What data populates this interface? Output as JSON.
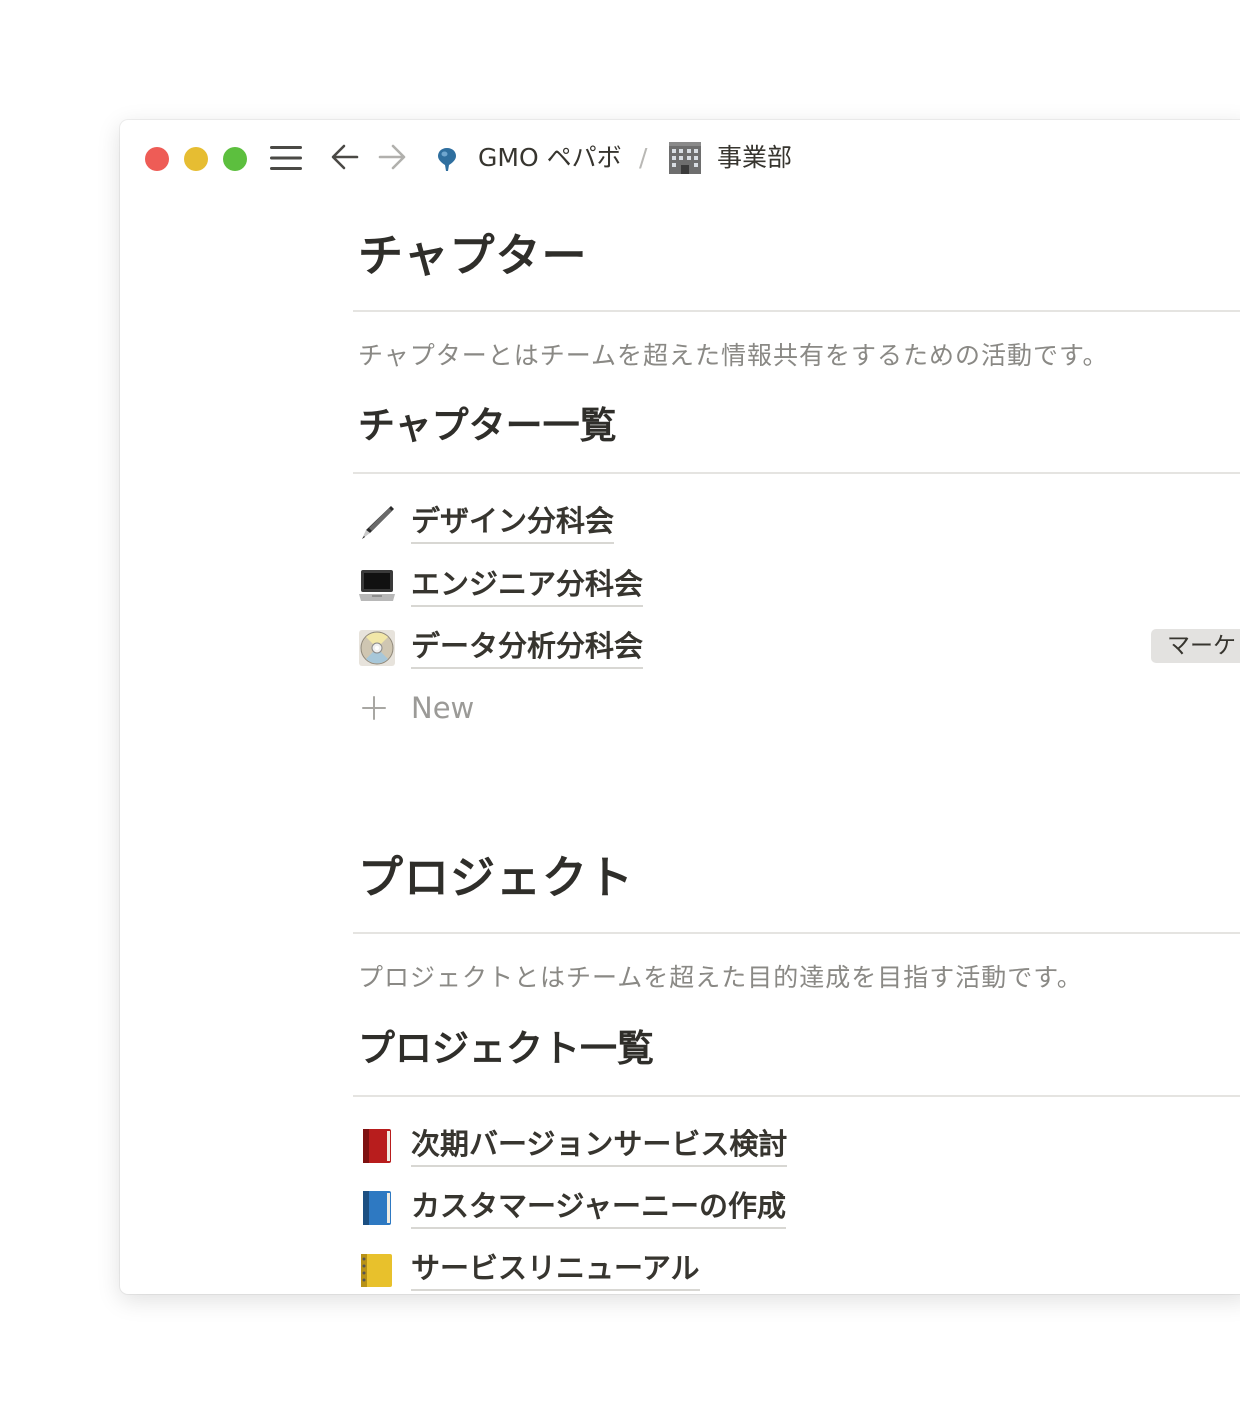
{
  "breadcrumb": {
    "workspace": "GMO ペパボ",
    "separator": "/",
    "page": "事業部"
  },
  "icons": {
    "menu": "hamburger-menu-icon",
    "back": "arrow-left-icon",
    "forward": "arrow-right-icon",
    "workspace": "pin-icon",
    "page": "office-building-icon"
  },
  "chapter": {
    "title": "チャプター",
    "description": "チャプターとはチームを超えた情報共有をするための活動です。",
    "list_title": "チャプター一覧",
    "items": [
      {
        "label": "デザイン分科会",
        "icon": "pen-icon"
      },
      {
        "label": "エンジニア分科会",
        "icon": "laptop-icon"
      },
      {
        "label": "データ分析分科会",
        "icon": "dvd-icon"
      }
    ],
    "tag": "マーケ",
    "new_label": "New"
  },
  "project": {
    "title": "プロジェクト",
    "description": "プロジェクトとはチームを超えた目的達成を目指す活動です。",
    "list_title": "プロジェクト一覧",
    "items": [
      {
        "label": "次期バージョンサービス検討",
        "icon": "red-book-icon"
      },
      {
        "label": "カスタマージャーニーの作成",
        "icon": "blue-book-icon"
      },
      {
        "label": "サービスリニューアル",
        "icon": "ledger-icon"
      }
    ]
  },
  "colors": {
    "close": "#ee5c56",
    "minimize": "#e6bd32",
    "zoom": "#5cbf3e",
    "text": "#37352f",
    "muted": "#8a8985",
    "tag_bg": "#e3e2e0"
  }
}
